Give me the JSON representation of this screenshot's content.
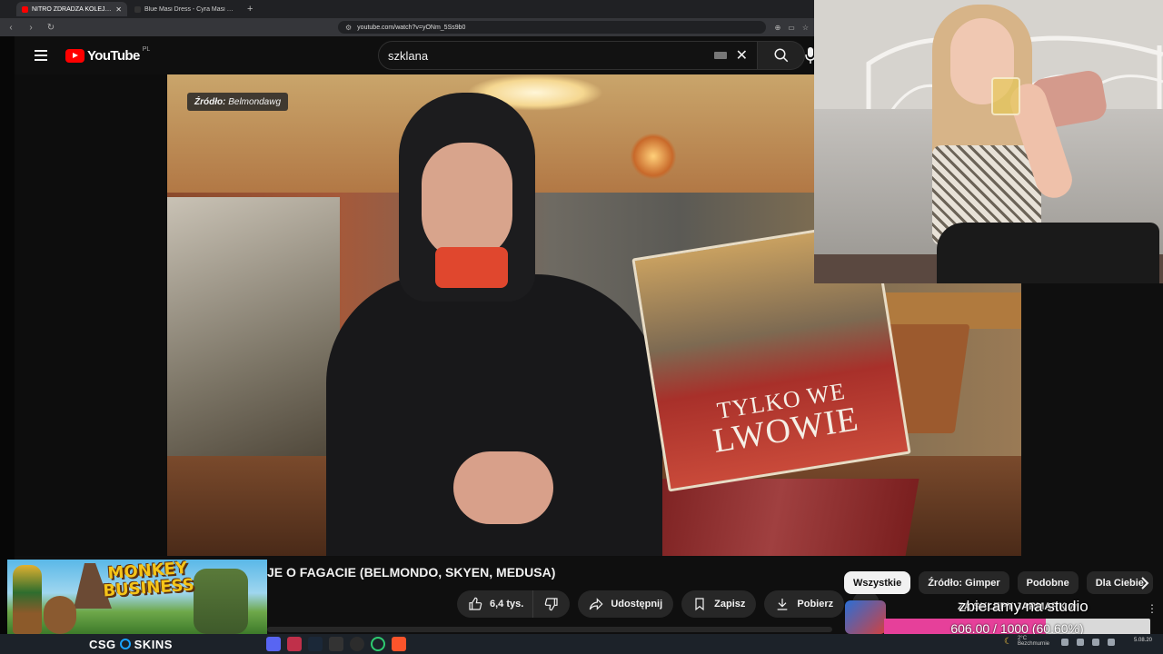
{
  "browser": {
    "tabs": [
      {
        "title": "NITRO ZDRADZA KOLEJNE INFO",
        "active": true
      },
      {
        "title": "Blue Masi Dress - Cyra Masi Dress -",
        "active": false
      }
    ],
    "url": "youtube.com/watch?v=yONm_5Ss9b0"
  },
  "youtube": {
    "logo_text": "YouTube",
    "country_code": "PL",
    "search_value": "szklana"
  },
  "video": {
    "source_label": "Źródło:",
    "source_name": "Belmondawg",
    "book_line1": "TYLKO WE",
    "book_line2": "LWOWIE",
    "title": "JE O FAGACIE (BELMONDO, SKYEN, MEDUSA)",
    "actions": {
      "like": "6,4 tys.",
      "share": "Udostępnij",
      "save": "Zapisz",
      "download": "Pobierz"
    }
  },
  "chips": [
    "Wszystkie",
    "Źródło: Gimper",
    "Podobne",
    "Dla Ciebie"
  ],
  "recommendation": {
    "title": "ZA SKLEPY JARMARK w",
    "overlay_text": "zbieramy na studio"
  },
  "goal": {
    "text": "606.00 / 1000 (60.60%)",
    "progress": 0.606,
    "color": "#e6409a"
  },
  "promo": {
    "line1": "MONKEY",
    "line2": "BUSINESS"
  },
  "taskbar": {
    "brand_left": "CSG",
    "brand_right": "SKINS",
    "weather_temp": "2°C",
    "weather_desc": "Bezchmurnie",
    "date": "5.08.20"
  },
  "colors": {
    "youtube_red": "#ff0000",
    "background": "#0f0f0f",
    "chip_bg": "#272727"
  }
}
